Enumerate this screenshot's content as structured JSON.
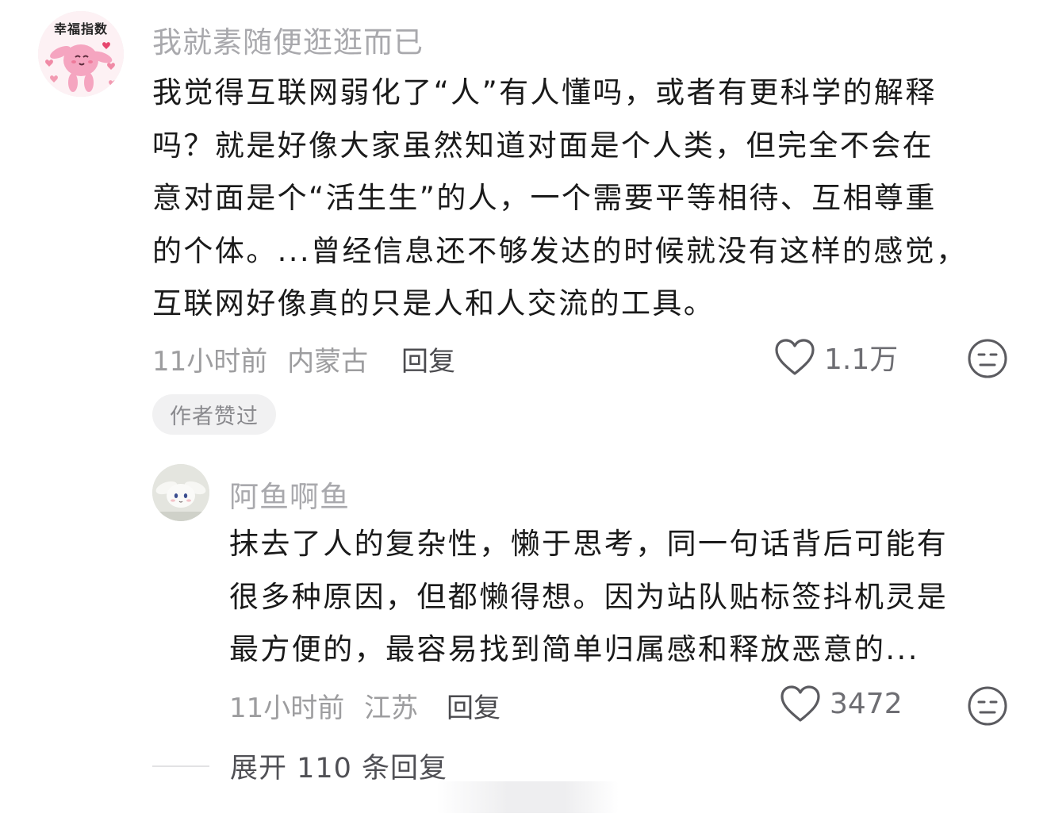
{
  "top_comment": {
    "avatar": {
      "caption": "幸福指数",
      "icon": "pink-rabbit-avatar"
    },
    "username": "我就素随便逛逛而已",
    "lines": [
      "我觉得互联网弱化了“人”有人懂吗，或者有更科学的解释",
      "吗？就是好像大家虽然知道对面是个人类，但完全不会在",
      "意对面是个“活生生”的人，一个需要平等相待、互相尊重",
      "的个体。...曾经信息还不够发达的时候就没有这样的感觉，",
      "互联网好像真的只是人和人交流的工具。"
    ],
    "time": "11小时前",
    "location": "内蒙古",
    "reply_label": "回复",
    "like_count": "1.1万",
    "badge": "作者赞过"
  },
  "reply_comment": {
    "avatar": {
      "icon": "cinnamoroll-plush-avatar"
    },
    "username": "阿鱼啊鱼",
    "lines": [
      "抹去了人的复杂性，懒于思考，同一句话背后可能有",
      "很多种原因，但都懒得想。因为站队贴标签抖机灵是",
      "最方便的，最容易找到简单归属感和释放恶意的..."
    ],
    "time": "11小时前",
    "location": "江苏",
    "reply_label": "回复",
    "like_count": "3472"
  },
  "expand_label": "展开 110 条回复",
  "colors": {
    "username": "#a9a9ad",
    "body": "#1a1a1a",
    "meta": "#9d9d9f",
    "badge_bg": "#f1f1f2"
  }
}
